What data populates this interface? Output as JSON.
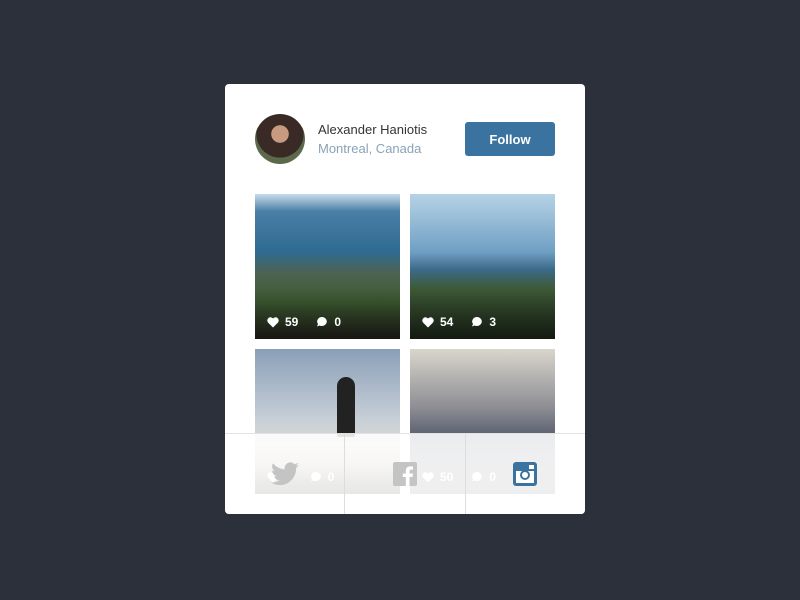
{
  "profile": {
    "name": "Alexander Haniotis",
    "location": "Montreal, Canada",
    "follow_label": "Follow"
  },
  "photos": [
    {
      "likes": "59",
      "comments": "0"
    },
    {
      "likes": "54",
      "comments": "3"
    },
    {
      "likes": "2",
      "comments": "0"
    },
    {
      "likes": "50",
      "comments": "0"
    }
  ],
  "social": [
    {
      "icon": "twitter-icon"
    },
    {
      "icon": "facebook-icon"
    },
    {
      "icon": "instagram-icon",
      "active": true
    }
  ],
  "colors": {
    "background": "#2b303a",
    "accent": "#3b73a0",
    "location": "#8aa3b8",
    "inactive_icon": "#c4c4c4"
  }
}
